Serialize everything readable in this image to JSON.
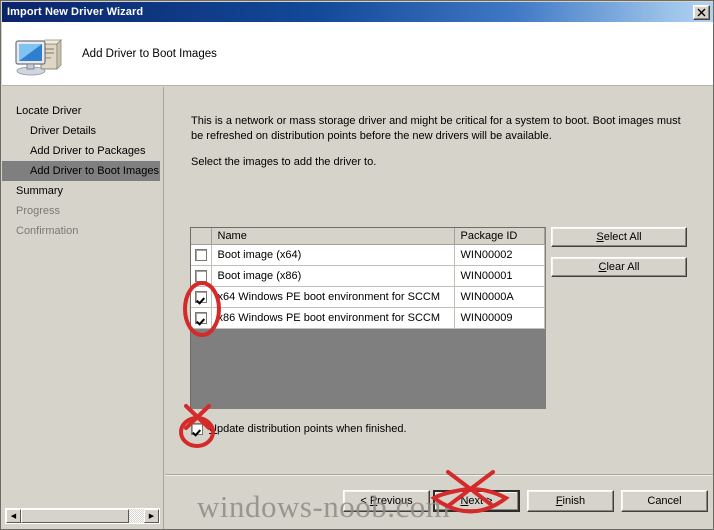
{
  "window": {
    "title": "Import New Driver Wizard",
    "close_label": "✕"
  },
  "header": {
    "icon": "computer-icon",
    "title": "Add Driver to Boot Images"
  },
  "sidebar": {
    "items": [
      {
        "label": "Locate Driver",
        "indent": false,
        "selected": false,
        "dim": false
      },
      {
        "label": "Driver Details",
        "indent": true,
        "selected": false,
        "dim": false
      },
      {
        "label": "Add Driver to Packages",
        "indent": true,
        "selected": false,
        "dim": false
      },
      {
        "label": "Add Driver to Boot Images",
        "indent": true,
        "selected": true,
        "dim": false
      },
      {
        "label": "Summary",
        "indent": false,
        "selected": false,
        "dim": false
      },
      {
        "label": "Progress",
        "indent": false,
        "selected": false,
        "dim": true
      },
      {
        "label": "Confirmation",
        "indent": false,
        "selected": false,
        "dim": true
      }
    ]
  },
  "main": {
    "paragraph1": "This is a network or mass storage driver and might be critical for a system to boot.  Boot images must be refreshed on distribution points before the new drivers will be available.",
    "paragraph2": "Select the images to add the driver to.",
    "table": {
      "columns": [
        "",
        "Name",
        "Package ID"
      ],
      "rows": [
        {
          "checked": false,
          "name": "Boot image (x64)",
          "package_id": "WIN00002"
        },
        {
          "checked": false,
          "name": "Boot image (x86)",
          "package_id": "WIN00001"
        },
        {
          "checked": true,
          "name": "x64 Windows PE boot environment for SCCM",
          "package_id": "WIN0000A"
        },
        {
          "checked": true,
          "name": "x86 Windows PE boot environment for SCCM",
          "package_id": "WIN00009"
        }
      ]
    },
    "select_all_label": "Select All",
    "select_all_accel": "S",
    "clear_all_label": "Clear All",
    "clear_all_accel": "C",
    "update_checkbox": {
      "checked": true,
      "accel": "U",
      "label": "pdate distribution points when finished."
    }
  },
  "footer": {
    "previous_label": "< ",
    "previous_accel": "P",
    "previous_rest": "revious",
    "next_accel": "N",
    "next_rest": "ext >",
    "finish_accel": "F",
    "finish_rest": "inish",
    "cancel_label": "Cancel"
  },
  "watermark": {
    "text": "windows-noob.com"
  },
  "colors": {
    "titlebar_start": "#0a246a",
    "titlebar_end": "#b3d2f2",
    "dialog_face": "#d6d3cb",
    "grid_empty": "#7f7f7f",
    "selected_item": "#7f7f7f",
    "annotation_red": "#d42a2a"
  }
}
